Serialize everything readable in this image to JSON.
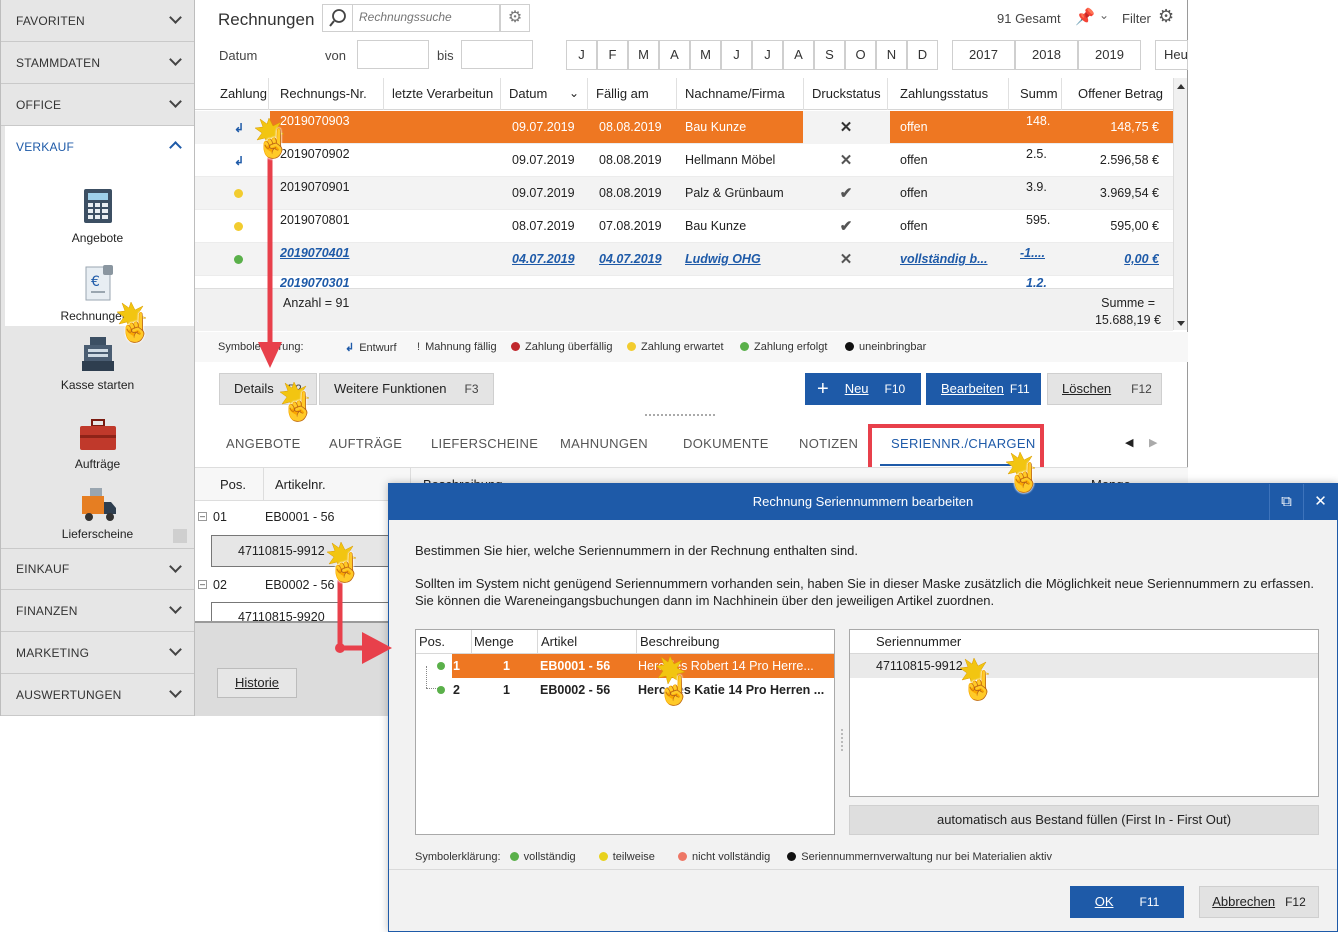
{
  "sidebar": {
    "sections": [
      {
        "label": "FAVORITEN"
      },
      {
        "label": "STAMMDATEN"
      },
      {
        "label": "OFFICE"
      },
      {
        "label": "VERKAUF"
      },
      {
        "label": "EINKAUF"
      },
      {
        "label": "FINANZEN"
      },
      {
        "label": "MARKETING"
      },
      {
        "label": "AUSWERTUNGEN"
      }
    ],
    "items": [
      {
        "label": "Angebote"
      },
      {
        "label": "Rechnungen"
      },
      {
        "label": "Kasse starten"
      },
      {
        "label": "Aufträge"
      },
      {
        "label": "Lieferscheine"
      }
    ]
  },
  "header": {
    "title": "Rechnungen",
    "search_placeholder": "Rechnungssuche",
    "total": "91 Gesamt",
    "filter_label": "Filter"
  },
  "datefilter": {
    "label": "Datum",
    "from_label": "von",
    "to_label": "bis",
    "months": [
      "J",
      "F",
      "M",
      "A",
      "M",
      "J",
      "J",
      "A",
      "S",
      "O",
      "N",
      "D"
    ],
    "years": [
      "2017",
      "2018",
      "2019"
    ],
    "today_label": "Heu"
  },
  "grid": {
    "columns": [
      "Zahlung",
      "Rechnungs-Nr.",
      "letzte Verarbeitun",
      "Datum",
      "Fällig am",
      "Nachname/Firma",
      "Druckstatus",
      "Zahlungsstatus",
      "Summ",
      "Offener Betrag"
    ],
    "rows": [
      {
        "nr": "2019070903",
        "datum": "09.07.2019",
        "faellig": "08.08.2019",
        "firma": "Bau Kunze",
        "status": "offen",
        "summe": "148.",
        "offen": "148,75 €",
        "druck": "✕"
      },
      {
        "nr": "2019070902",
        "datum": "09.07.2019",
        "faellig": "08.08.2019",
        "firma": "Hellmann Möbel",
        "status": "offen",
        "summe": "2.5.",
        "offen": "2.596,58 €",
        "druck": "✕"
      },
      {
        "nr": "2019070901",
        "datum": "09.07.2019",
        "faellig": "08.08.2019",
        "firma": "Palz & Grünbaum",
        "status": "offen",
        "summe": "3.9.",
        "offen": "3.969,54 €",
        "druck": "✔"
      },
      {
        "nr": "2019070801",
        "datum": "08.07.2019",
        "faellig": "07.08.2019",
        "firma": "Bau Kunze",
        "status": "offen",
        "summe": "595.",
        "offen": "595,00 €",
        "druck": "✔"
      },
      {
        "nr": "2019070401",
        "datum": "04.07.2019",
        "faellig": "04.07.2019",
        "firma": "Ludwig OHG",
        "status": "vollständig b...",
        "summe": "-1....",
        "offen": "0,00 €",
        "druck": "✕"
      },
      {
        "nr": "2019070301",
        "summe": "1.2."
      }
    ],
    "count": "Anzahl = 91",
    "sum_label": "Summe =",
    "sum_value": "15.688,19 €"
  },
  "legend": {
    "prefix": "Symbolerklärung:",
    "items": [
      {
        "label": "Entwurf"
      },
      {
        "label": "Mahnung fällig"
      },
      {
        "label": "Zahlung überfällig",
        "color": "#c0282d"
      },
      {
        "label": "Zahlung erwartet",
        "color": "#f2cc2f"
      },
      {
        "label": "Zahlung erfolgt",
        "color": "#5ab04a"
      },
      {
        "label": "uneinbringbar",
        "color": "#111111"
      }
    ]
  },
  "actions": {
    "details": "Details",
    "details_key": "F2",
    "more": "Weitere Funktionen",
    "more_key": "F3",
    "new": "Neu",
    "new_key": "F10",
    "edit": "Bearbeiten",
    "edit_key": "F11",
    "delete": "Löschen",
    "delete_key": "F12"
  },
  "tabs": [
    "ANGEBOTE",
    "AUFTRÄGE",
    "LIEFERSCHEINE",
    "MAHNUNGEN",
    "DOKUMENTE",
    "NOTIZEN",
    "SERIENNR./CHARGEN"
  ],
  "detail": {
    "col_pos": "Pos.",
    "col_art": "Artikelnr.",
    "col_desc": "Beschreibung",
    "col_qty": "Menge",
    "rows": [
      {
        "pos": "01",
        "art": "EB0001 - 56",
        "serial": "47110815-9912"
      },
      {
        "pos": "02",
        "art": "EB0002 - 56",
        "serial": "47110815-9920"
      }
    ],
    "history": "Historie"
  },
  "dialog": {
    "title": "Rechnung Seriennummern bearbeiten",
    "text1": "Bestimmen Sie hier, welche Seriennummern in der Rechnung enthalten sind.",
    "text2": "Sollten im System nicht genügend Seriennummern vorhanden sein, haben Sie in dieser Maske zusätzlich die Möglichkeit neue Seriennummern zu erfassen. Sie können die Wareneingangsbuchungen dann im Nachhinein über den jeweiligen Artikel zuordnen.",
    "left_cols": [
      "Pos.",
      "Menge",
      "Artikel",
      "Beschreibung"
    ],
    "left_rows": [
      {
        "pos": "1",
        "menge": "1",
        "artikel": "EB0001 - 56",
        "beschreibung": "Hercules Robert 14 Pro Herre..."
      },
      {
        "pos": "2",
        "menge": "1",
        "artikel": "EB0002 - 56",
        "beschreibung": "Hercules Katie 14 Pro Herren ..."
      }
    ],
    "right_col": "Seriennummer",
    "right_rows": [
      "47110815-9912"
    ],
    "fill_button": "automatisch aus Bestand füllen (First In - First Out)",
    "legend_prefix": "Symbolerklärung:",
    "legend": [
      {
        "label": "vollständig",
        "color": "#5ab04a"
      },
      {
        "label": "teilweise",
        "color": "#e8d21d"
      },
      {
        "label": "nicht vollständig",
        "color": "#ee7766"
      },
      {
        "label": "Seriennummernverwaltung  nur bei Materialien aktiv",
        "color": "#111111"
      }
    ],
    "ok": "OK",
    "ok_key": "F11",
    "cancel": "Abbrechen",
    "cancel_key": "F12"
  }
}
